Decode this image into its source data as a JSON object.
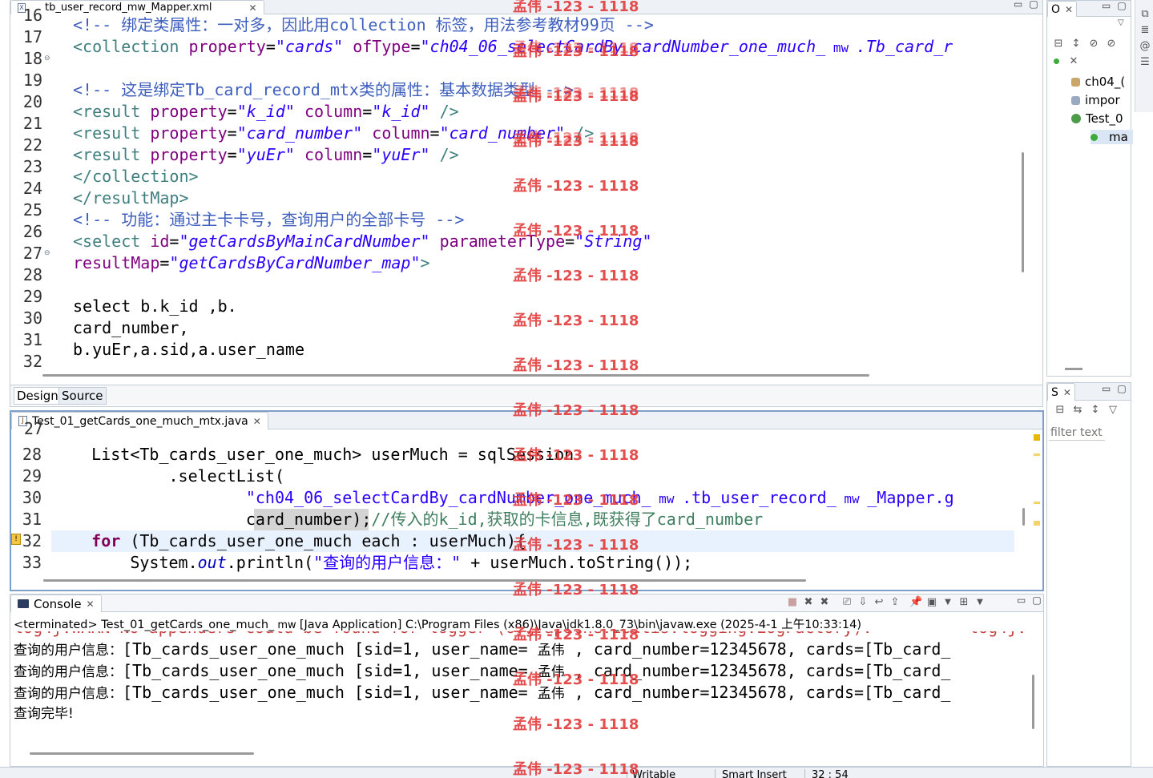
{
  "editor_xml": {
    "tab_label": "tb_user_record_mw_Mapper.xml",
    "first_partial": "16",
    "line_numbers": [
      "17",
      "18",
      "19",
      "20",
      "21",
      "22",
      "23",
      "24",
      "25",
      "26",
      "27",
      "28",
      "29",
      "30",
      "31",
      "32"
    ],
    "lines": [
      {
        "n": "17",
        "parts": [
          [
            "c-comment",
            "<!-- 绑定类属性：一对多，因此用collection 标签，用法参考教材99页 -->"
          ]
        ]
      },
      {
        "n": "18",
        "parts": [
          [
            "c-tag",
            "<collection "
          ],
          [
            "c-attr",
            "property"
          ],
          [
            "",
            "="
          ],
          [
            "c-str",
            "\"cards\""
          ],
          [
            "c-attr",
            " ofType"
          ],
          [
            "",
            "="
          ],
          [
            "c-str",
            "\"ch04_06_selectCardBy_cardNumber_one_much_"
          ],
          [
            "c-str c-mw",
            " mw "
          ],
          [
            "c-str",
            ".Tb_card_r"
          ]
        ]
      },
      {
        "n": "19",
        "parts": [
          [
            "",
            ""
          ]
        ]
      },
      {
        "n": "20",
        "parts": [
          [
            "c-comment",
            "<!-- 这是绑定Tb_card_record_mtx类的属性：基本数据类型 -->"
          ]
        ]
      },
      {
        "n": "21",
        "parts": [
          [
            "c-tag",
            "<result "
          ],
          [
            "c-attr",
            "property"
          ],
          [
            "",
            "="
          ],
          [
            "c-str",
            "\"k_id\""
          ],
          [
            "c-attr",
            " column"
          ],
          [
            "",
            "="
          ],
          [
            "c-str",
            "\"k_id\""
          ],
          [
            "c-tag",
            " />"
          ]
        ]
      },
      {
        "n": "22",
        "parts": [
          [
            "c-tag",
            "<result "
          ],
          [
            "c-attr",
            "property"
          ],
          [
            "",
            "="
          ],
          [
            "c-str",
            "\"card_number\""
          ],
          [
            "c-attr",
            " column"
          ],
          [
            "",
            "="
          ],
          [
            "c-str",
            "\"card_number\""
          ],
          [
            "c-tag",
            " />"
          ]
        ]
      },
      {
        "n": "23",
        "parts": [
          [
            "c-tag",
            "<result "
          ],
          [
            "c-attr",
            "property"
          ],
          [
            "",
            "="
          ],
          [
            "c-str",
            "\"yuEr\""
          ],
          [
            "c-attr",
            " column"
          ],
          [
            "",
            "="
          ],
          [
            "c-str",
            "\"yuEr\""
          ],
          [
            "c-tag",
            " />"
          ]
        ]
      },
      {
        "n": "24",
        "parts": [
          [
            "c-tag",
            "</collection>"
          ]
        ]
      },
      {
        "n": "25",
        "parts": [
          [
            "c-tag",
            "</resultMap>"
          ]
        ]
      },
      {
        "n": "26",
        "parts": [
          [
            "c-comment",
            "<!-- 功能：通过主卡卡号，查询用户的全部卡号 -->"
          ]
        ]
      },
      {
        "n": "27",
        "parts": [
          [
            "c-tag",
            "<select "
          ],
          [
            "c-attr",
            "id"
          ],
          [
            "",
            "="
          ],
          [
            "c-str",
            "\"getCardsByMainCardNumber\""
          ],
          [
            "c-attr",
            " parameterType"
          ],
          [
            "",
            "="
          ],
          [
            "c-str",
            "\"String\""
          ]
        ]
      },
      {
        "n": "28",
        "parts": [
          [
            "c-attr",
            "resultMap"
          ],
          [
            "",
            "="
          ],
          [
            "c-str",
            "\"getCardsByCardNumber_map\""
          ],
          [
            "c-tag",
            ">"
          ]
        ]
      },
      {
        "n": "29",
        "parts": [
          [
            "",
            ""
          ]
        ]
      },
      {
        "n": "30",
        "parts": [
          [
            "",
            "select b.k_id ,b."
          ]
        ]
      },
      {
        "n": "31",
        "parts": [
          [
            "",
            "card_number,"
          ]
        ]
      },
      {
        "n": "32",
        "parts": [
          [
            "",
            "b.yuEr,a.sid,a.user_name"
          ]
        ]
      }
    ],
    "bottom_tabs": [
      "Design",
      "Source"
    ]
  },
  "editor_java": {
    "tab_label": "Test_01_getCards_one_much_mtx.java",
    "first_partial": "27",
    "lines": [
      {
        "n": "28",
        "parts": [
          [
            "",
            "    List<Tb_cards_user_one_much> userMuch = sqlSession"
          ]
        ]
      },
      {
        "n": "29",
        "parts": [
          [
            "",
            "            .selectList("
          ]
        ]
      },
      {
        "n": "30",
        "parts": [
          [
            "c-jstr",
            "                    \"ch04_06_selectCardBy_cardNumber_one_much_"
          ],
          [
            "c-jstr c-mw",
            " mw "
          ],
          [
            "c-jstr",
            ".tb_user_record_"
          ],
          [
            "c-jstr c-mw",
            " mw "
          ],
          [
            "c-jstr",
            "_Mapper.g"
          ]
        ]
      },
      {
        "n": "31",
        "parts": [
          [
            "",
            "                    card_number"
          ],
          [
            "",
            ");"
          ],
          [
            "c-jcomment",
            "//传入的k_id,获取的卡信息,既获得了card_number"
          ]
        ]
      },
      {
        "n": "32",
        "parts": [
          [
            "",
            "    "
          ],
          [
            "c-kw",
            "for"
          ],
          [
            "",
            " (Tb_cards_user_one_much each : userMuch){"
          ]
        ]
      },
      {
        "n": "33",
        "parts": [
          [
            "",
            "        System."
          ],
          [
            "c-field",
            "out"
          ],
          [
            "",
            ".println("
          ],
          [
            "c-jstr",
            "\"查询的用户信息：\""
          ],
          [
            "",
            " + userMuch.toString());"
          ]
        ]
      }
    ]
  },
  "outline": {
    "tab_label": "O",
    "items": [
      "ch04_(",
      "impor",
      "Test_0",
      "ma"
    ]
  },
  "second_view": {
    "tab_label": "S",
    "filter_placeholder": "filter text"
  },
  "console": {
    "tab_label": "Console",
    "status_line_parts": [
      "<terminated> Test_01_getCards_one_much_",
      " mw ",
      "[Java Application] C:\\Program Files (x86)\\Java\\jdk1.8.0_73\\bin\\javaw.exe (2025-4-1 上午10:33:14)"
    ],
    "output_lines": [
      [
        "查询的用户信息：",
        "[Tb_cards_user_one_much [sid=1, user_name= ",
        "孟伟",
        " , card_number=12345678, cards=[Tb_card_"
      ],
      [
        "查询的用户信息：",
        "[Tb_cards_user_one_much [sid=1, user_name= ",
        "孟伟",
        " , card_number=12345678, cards=[Tb_card_"
      ],
      [
        "查询的用户信息：",
        "[Tb_cards_user_one_much [sid=1, user_name= ",
        "孟伟",
        " , card_number=12345678, cards=[Tb_card_"
      ]
    ],
    "done_text": "查询完毕!"
  },
  "status_bar": {
    "writable": "Writable",
    "insert_mode": "Smart Insert",
    "position": "32 : 54"
  },
  "watermark_text": "孟伟 -123 - 1118",
  "colors": {
    "accent_border": "#7d9fc9",
    "current_line": "#e8f2fe",
    "watermark": "#e23b3b"
  }
}
